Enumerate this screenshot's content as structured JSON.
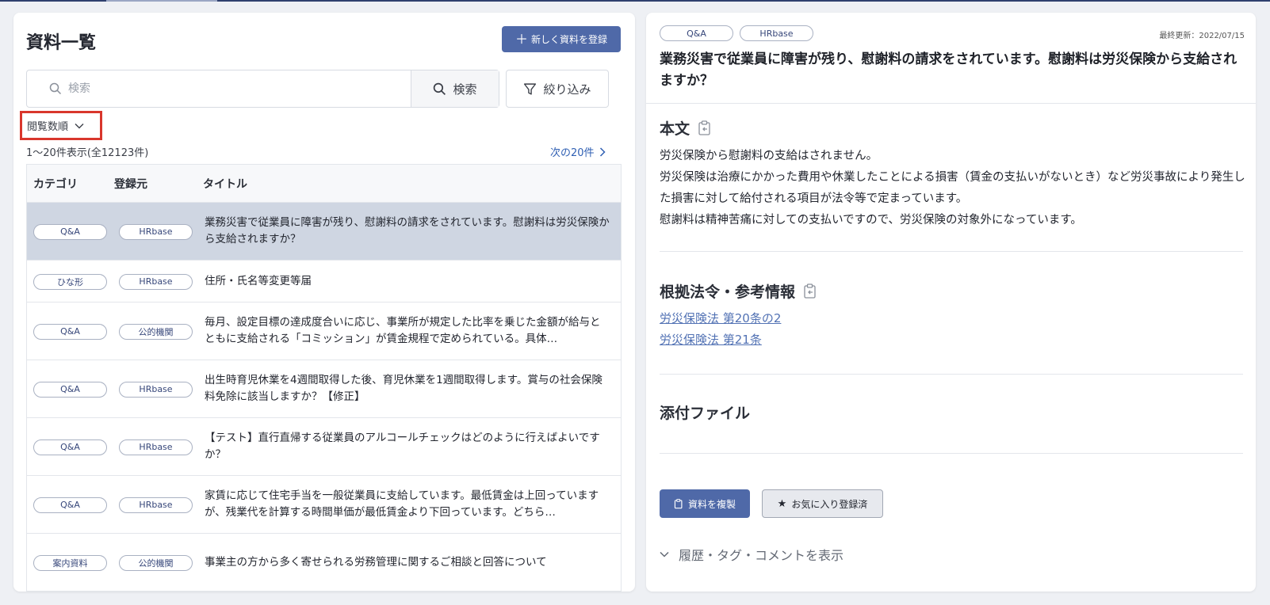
{
  "list": {
    "title": "資料一覧",
    "new_button": "新しく資料を登録",
    "search_placeholder": "検索",
    "search_button": "検索",
    "filter_button": "絞り込み",
    "sort_label": "閲覧数順",
    "count_text": "1～20件表示(全12123件)",
    "next_text": "次の20件",
    "columns": [
      "カテゴリ",
      "登録元",
      "タイトル"
    ],
    "rows": [
      {
        "category": "Q&A",
        "source": "HRbase",
        "title": "業務災害で従業員に障害が残り、慰謝料の請求をされています。慰謝料は労災保険から支給されますか？"
      },
      {
        "category": "ひな形",
        "source": "HRbase",
        "title": "住所・氏名等変更等届"
      },
      {
        "category": "Q&A",
        "source": "公的機関",
        "title": "毎月、設定目標の達成度合いに応じ、事業所が規定した比率を乗じた金額が給与とともに支給される「コミッション」が賃金規程で定められている。具体…"
      },
      {
        "category": "Q&A",
        "source": "HRbase",
        "title": "出生時育児休業を4週間取得した後、育児休業を1週間取得します。賞与の社会保険料免除に該当しますか？【修正】"
      },
      {
        "category": "Q&A",
        "source": "HRbase",
        "title": "【テスト】直行直帰する従業員のアルコールチェックはどのように行えばよいですか？"
      },
      {
        "category": "Q&A",
        "source": "HRbase",
        "title": "家賃に応じて住宅手当を一般従業員に支給しています。最低賃金は上回っていますが、残業代を計算する時間単価が最低賃金より下回っています。どちら…"
      },
      {
        "category": "案内資料",
        "source": "公的機関",
        "title": "事業主の方から多く寄せられる労務管理に関するご相談と回答について"
      }
    ]
  },
  "detail": {
    "tags": [
      "Q&A",
      "HRbase"
    ],
    "updated": "最終更新：2022/07/15",
    "title": "業務災害で従業員に障害が残り、慰謝料の請求をされています。慰謝料は労災保険から支給されますか？",
    "body_heading": "本文",
    "body_lines": [
      "労災保険から慰謝料の支給はされません。",
      "労災保険は治療にかかった費用や休業したことによる損害（賃金の支払いがないとき）など労災事故により発生した損害に対して給付される項目が法令等で定まっています。",
      "慰謝料は精神苦痛に対しての支払いですので、労災保険の対象外になっています。"
    ],
    "law_heading": "根拠法令・参考情報",
    "law_links": [
      "労災保険法 第20条の2",
      "労災保険法 第21条"
    ],
    "attach_heading": "添付ファイル",
    "copy_button": "資料を複製",
    "fav_button": "お気に入り登録済",
    "toggle_text": "履歴・タグ・コメントを表示"
  }
}
